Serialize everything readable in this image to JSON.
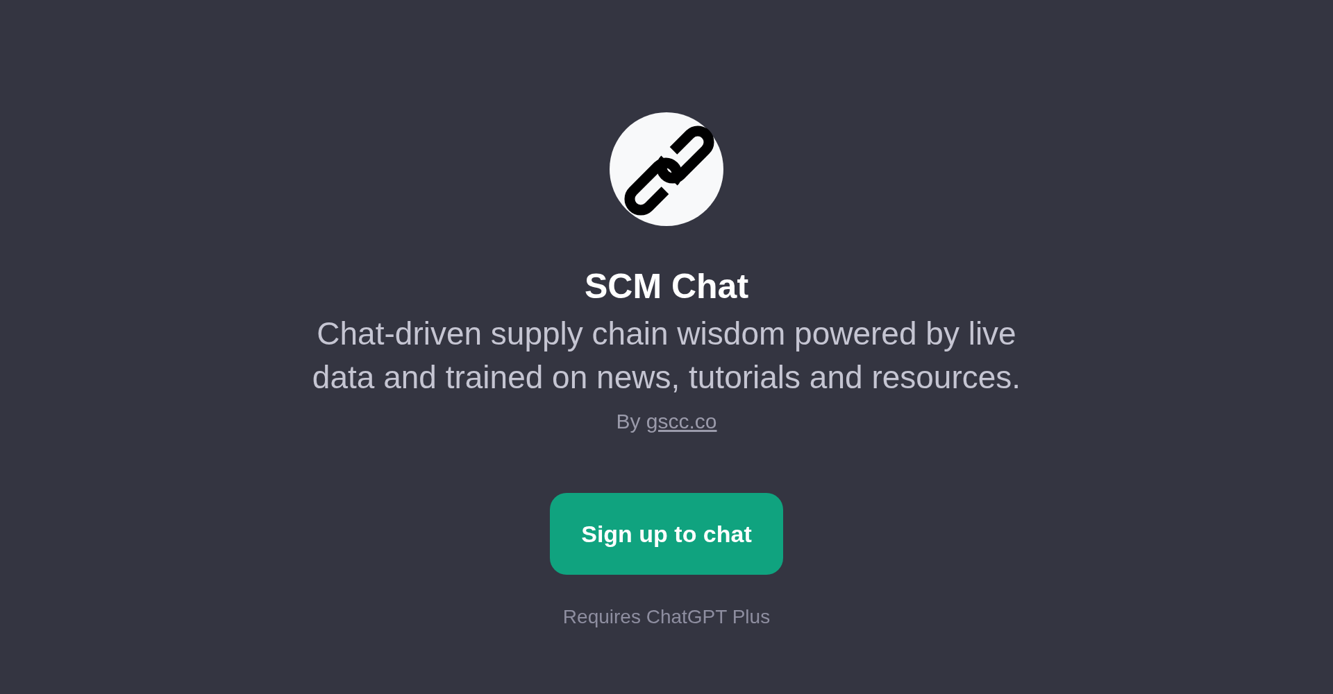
{
  "gpt": {
    "name": "SCM Chat",
    "description": "Chat-driven supply chain wisdom powered by live data and trained on news, tutorials and resources.",
    "byline": {
      "prefix": "By",
      "link": "gscc.co"
    }
  },
  "signup_button": {
    "label": "Sign up to chat"
  },
  "requirement_note": "Requires ChatGPT Plus"
}
